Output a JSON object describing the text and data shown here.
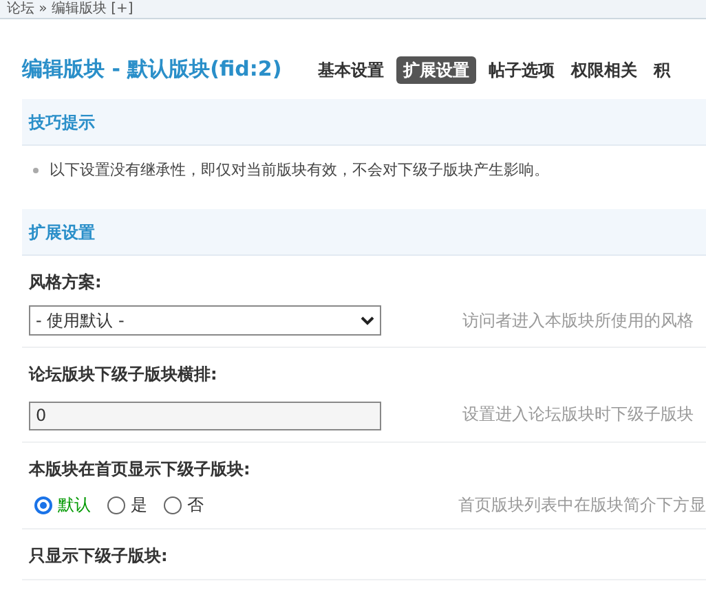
{
  "breadcrumb": "论坛 » 编辑版块 [+]",
  "title": "编辑版块 - 默认版块(fid:2)",
  "tabs": [
    {
      "label": "基本设置",
      "selected": false
    },
    {
      "label": "扩展设置",
      "selected": true
    },
    {
      "label": "帖子选项",
      "selected": false
    },
    {
      "label": "权限相关",
      "selected": false
    },
    {
      "label": "积",
      "selected": false
    }
  ],
  "tips": {
    "title": "技巧提示",
    "items": [
      "以下设置没有继承性，即仅对当前版块有效，不会对下级子版块产生影响。"
    ]
  },
  "section": {
    "title": "扩展设置",
    "settings": [
      {
        "kind": "select",
        "label": "风格方案:",
        "value": "- 使用默认 -",
        "description": "访问者进入本版块所使用的风格"
      },
      {
        "kind": "text",
        "label": "论坛版块下级子版块横排:",
        "value": "0",
        "description": "设置进入论坛版块时下级子版块"
      },
      {
        "kind": "radio",
        "label": "本版块在首页显示下级子版块:",
        "options": [
          {
            "label": "默认",
            "selected": true
          },
          {
            "label": "是",
            "selected": false
          },
          {
            "label": "否",
            "selected": false
          }
        ],
        "description": "首页版块列表中在版块简介下方显"
      },
      {
        "kind": "label",
        "label": "只显示下级子版块:"
      }
    ]
  }
}
